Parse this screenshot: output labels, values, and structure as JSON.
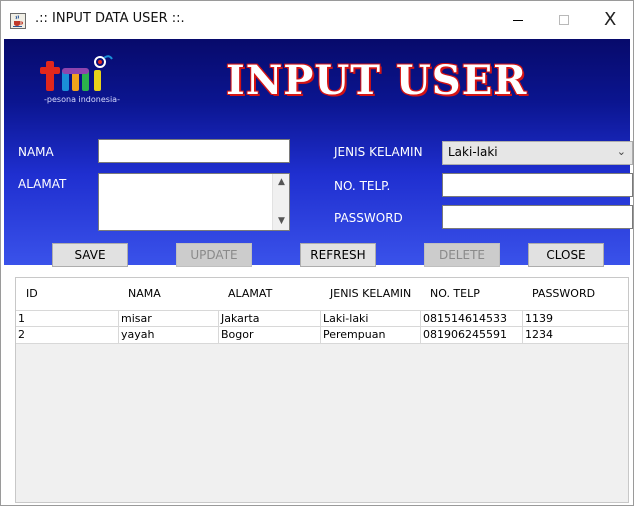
{
  "window": {
    "title": ".:: INPUT DATA USER ::.",
    "controls": {
      "minimize": "—",
      "maximize": "☐",
      "close": "X"
    }
  },
  "header": {
    "logo_text": "tmi",
    "logo_tagline": "-pesona indonesia-",
    "title": "INPUT USER"
  },
  "form": {
    "nama": {
      "label": "NAMA",
      "value": ""
    },
    "alamat": {
      "label": "ALAMAT",
      "value": ""
    },
    "jenis_kelamin": {
      "label": "JENIS KELAMIN",
      "value": "Laki-laki"
    },
    "telp": {
      "label": "NO. TELP.",
      "value": ""
    },
    "password": {
      "label": "PASSWORD",
      "value": ""
    }
  },
  "buttons": {
    "save": "SAVE",
    "update": "UPDATE",
    "refresh": "REFRESH",
    "delete": "DELETE",
    "close": "CLOSE"
  },
  "table": {
    "columns": [
      "ID",
      "NAMA",
      "ALAMAT",
      "JENIS KELAMIN",
      "NO. TELP",
      "PASSWORD"
    ],
    "rows": [
      [
        "1",
        "misar",
        "Jakarta",
        "Laki-laki",
        "081514614533",
        "1139"
      ],
      [
        "2",
        "yayah",
        "Bogor",
        "Perempuan",
        "081906245591",
        "1234"
      ]
    ]
  },
  "colors": {
    "panel_top": "#070a6b",
    "panel_bottom": "#3a52ea",
    "title_outline": "#d41414"
  },
  "icons": {
    "app": "java-cup-icon",
    "dropdown": "chevron-down-icon",
    "scroll_up": "caret-up-icon",
    "scroll_down": "caret-down-icon"
  }
}
